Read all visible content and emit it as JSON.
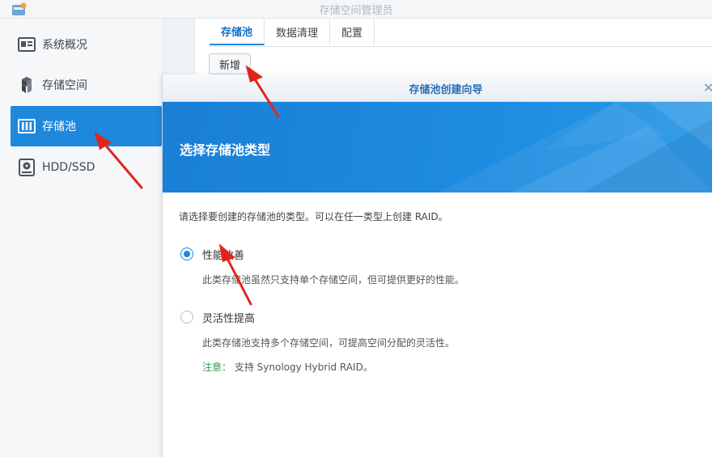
{
  "window": {
    "title": "存储空间管理员"
  },
  "sidebar": {
    "items": [
      {
        "label": "系统概况",
        "icon": "overview-icon"
      },
      {
        "label": "存储空间",
        "icon": "volume-icon"
      },
      {
        "label": "存储池",
        "icon": "storage-pool-icon",
        "active": true
      },
      {
        "label": "HDD/SSD",
        "icon": "disk-icon"
      }
    ]
  },
  "main": {
    "tabs": [
      {
        "label": "存储池",
        "active": true
      },
      {
        "label": "数据清理"
      },
      {
        "label": "配置"
      }
    ],
    "add_label": "新增"
  },
  "dialog": {
    "title": "存储池创建向导",
    "close_label": "✕",
    "banner_title": "选择存储池类型",
    "description": "请选择要创建的存储池的类型。可以在任一类型上创建 RAID。",
    "options": [
      {
        "label": "性能改善",
        "desc": "此类存储池虽然只支持单个存储空间，但可提供更好的性能。",
        "selected": true
      },
      {
        "label": "灵活性提高",
        "desc": "此类存储池支持多个存储空间，可提高空间分配的灵活性。",
        "selected": false
      }
    ],
    "note_label": "注意：",
    "note_text": "支持 Synology Hybrid RAID。"
  },
  "colors": {
    "accent": "#1e88dd",
    "annotation_arrow": "#e0251b",
    "note": "#2e9b57"
  }
}
